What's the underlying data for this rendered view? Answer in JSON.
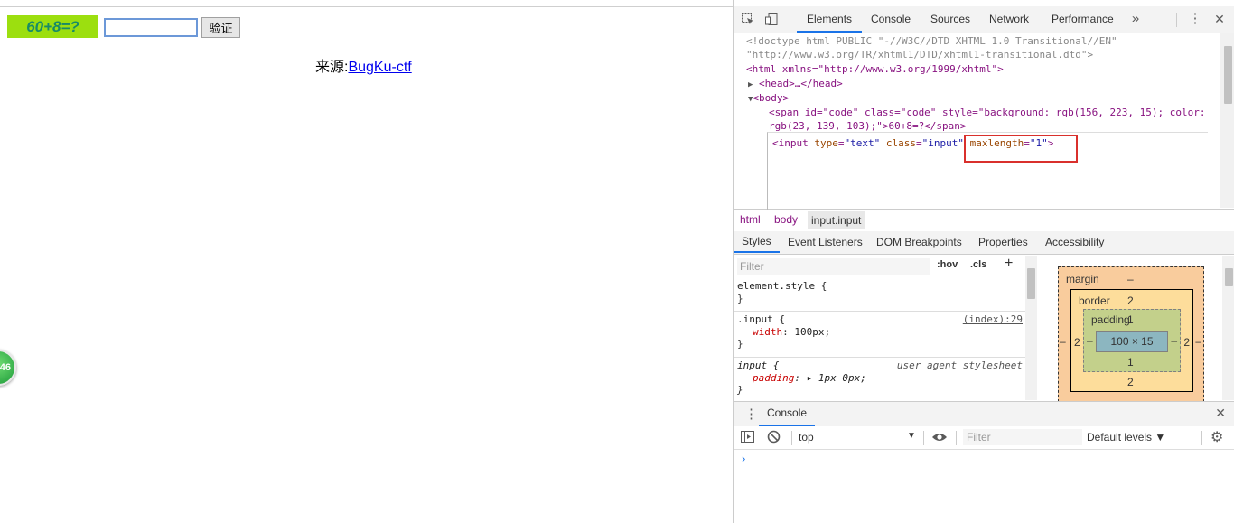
{
  "page": {
    "captcha_text": "60+8=?",
    "captcha_bg": "#9cdf0f",
    "captcha_color": "#178b67",
    "input_value": "",
    "verify_label": "验证",
    "source_label": "来源:",
    "source_link": "BugKu-ctf",
    "badge_text": "46"
  },
  "devtools": {
    "tabs": [
      "Elements",
      "Console",
      "Sources",
      "Network",
      "Performance"
    ],
    "active_tab": "Elements",
    "more_icon": "»",
    "menu_icon": "⋮",
    "close_icon": "✕",
    "elements": {
      "doctype_1": "<!doctype html PUBLIC \"-//W3C//DTD XHTML 1.0 Transitional//EN\"",
      "doctype_2": "\"http://www.w3.org/TR/xhtml1/DTD/xhtml1-transitional.dtd\">",
      "html_open": "<html xmlns=\"http://www.w3.org/1999/xhtml\">",
      "head": "<head>…</head>",
      "body_open": "<body>",
      "span_1": "<span id=\"code\" class=\"code\" style=\"background: rgb(156, 223, 15); color:",
      "span_2": "rgb(23, 139, 103);\">60+8=?</span>",
      "input_tag_open": "<input ",
      "input_attr_type": "type",
      "input_val_type": "\"text\"",
      "input_attr_class": "class",
      "input_val_class": "\"input\"",
      "input_attr_maxlength": "maxlength",
      "input_val_maxlength": "\"1\"",
      "input_tag_close": ">"
    },
    "breadcrumbs": [
      "html",
      "body",
      "input.input"
    ],
    "sub_tabs": [
      "Styles",
      "Event Listeners",
      "DOM Breakpoints",
      "Properties",
      "Accessibility"
    ],
    "active_sub_tab": "Styles",
    "filter_placeholder": "Filter",
    "hov_label": ":hov",
    "cls_label": ".cls",
    "plus_label": "+",
    "rules": {
      "element_style": "element.style {",
      "close": "}",
      "input_class_selector": ".input {",
      "input_class_source": "(index):29",
      "width_name": "width",
      "width_value": "100px;",
      "input_selector": "input {",
      "ua_label": "user agent stylesheet",
      "padding_name": "padding",
      "padding_value": "▸ 1px 0px;"
    },
    "box_model": {
      "margin_label": "margin",
      "margin_top": "–",
      "margin_left": "–",
      "margin_right": "–",
      "border_label": "border",
      "border_top": "2",
      "border_left": "2",
      "border_right": "2",
      "border_bottom": "2",
      "padding_label": "padding",
      "padding_top": "1",
      "padding_left": "–",
      "padding_right": "–",
      "padding_bottom": "1",
      "content": "100 × 15"
    },
    "console": {
      "drawer_label": "Console",
      "context": "top",
      "filter_placeholder": "Filter",
      "levels": "Default levels ▼",
      "prompt": "›"
    }
  }
}
